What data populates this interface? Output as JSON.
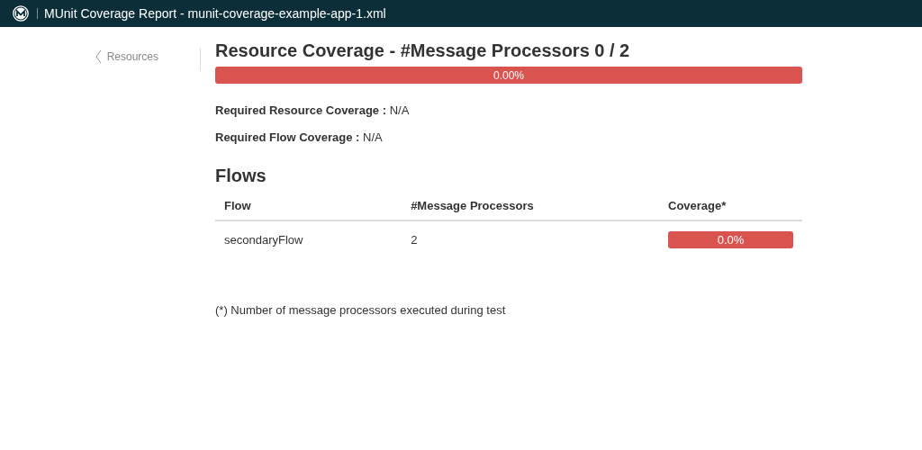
{
  "window": {
    "title": "MUnit Coverage Report - munit-coverage-example-app-1.xml"
  },
  "sidebar": {
    "back_link": "Resources"
  },
  "heading": "Resource Coverage - #Message Processors 0 / 2",
  "coverage_bar": {
    "level": 0,
    "reading": "0.00%"
  },
  "requirements": [
    {
      "label": "Required Resource Coverage :",
      "value": "N/A"
    },
    {
      "label": "Required Flow Coverage :",
      "value": "N/A"
    }
  ],
  "flows": {
    "title": "Flows",
    "columns": [
      "Flow",
      "#Message Processors",
      "Coverage*"
    ],
    "rows": [
      {
        "flow": "secondaryFlow",
        "processors": "2",
        "level": 0,
        "coverage": "0.0%"
      }
    ]
  },
  "footnote": "(*) Number of message processors executed during test"
}
